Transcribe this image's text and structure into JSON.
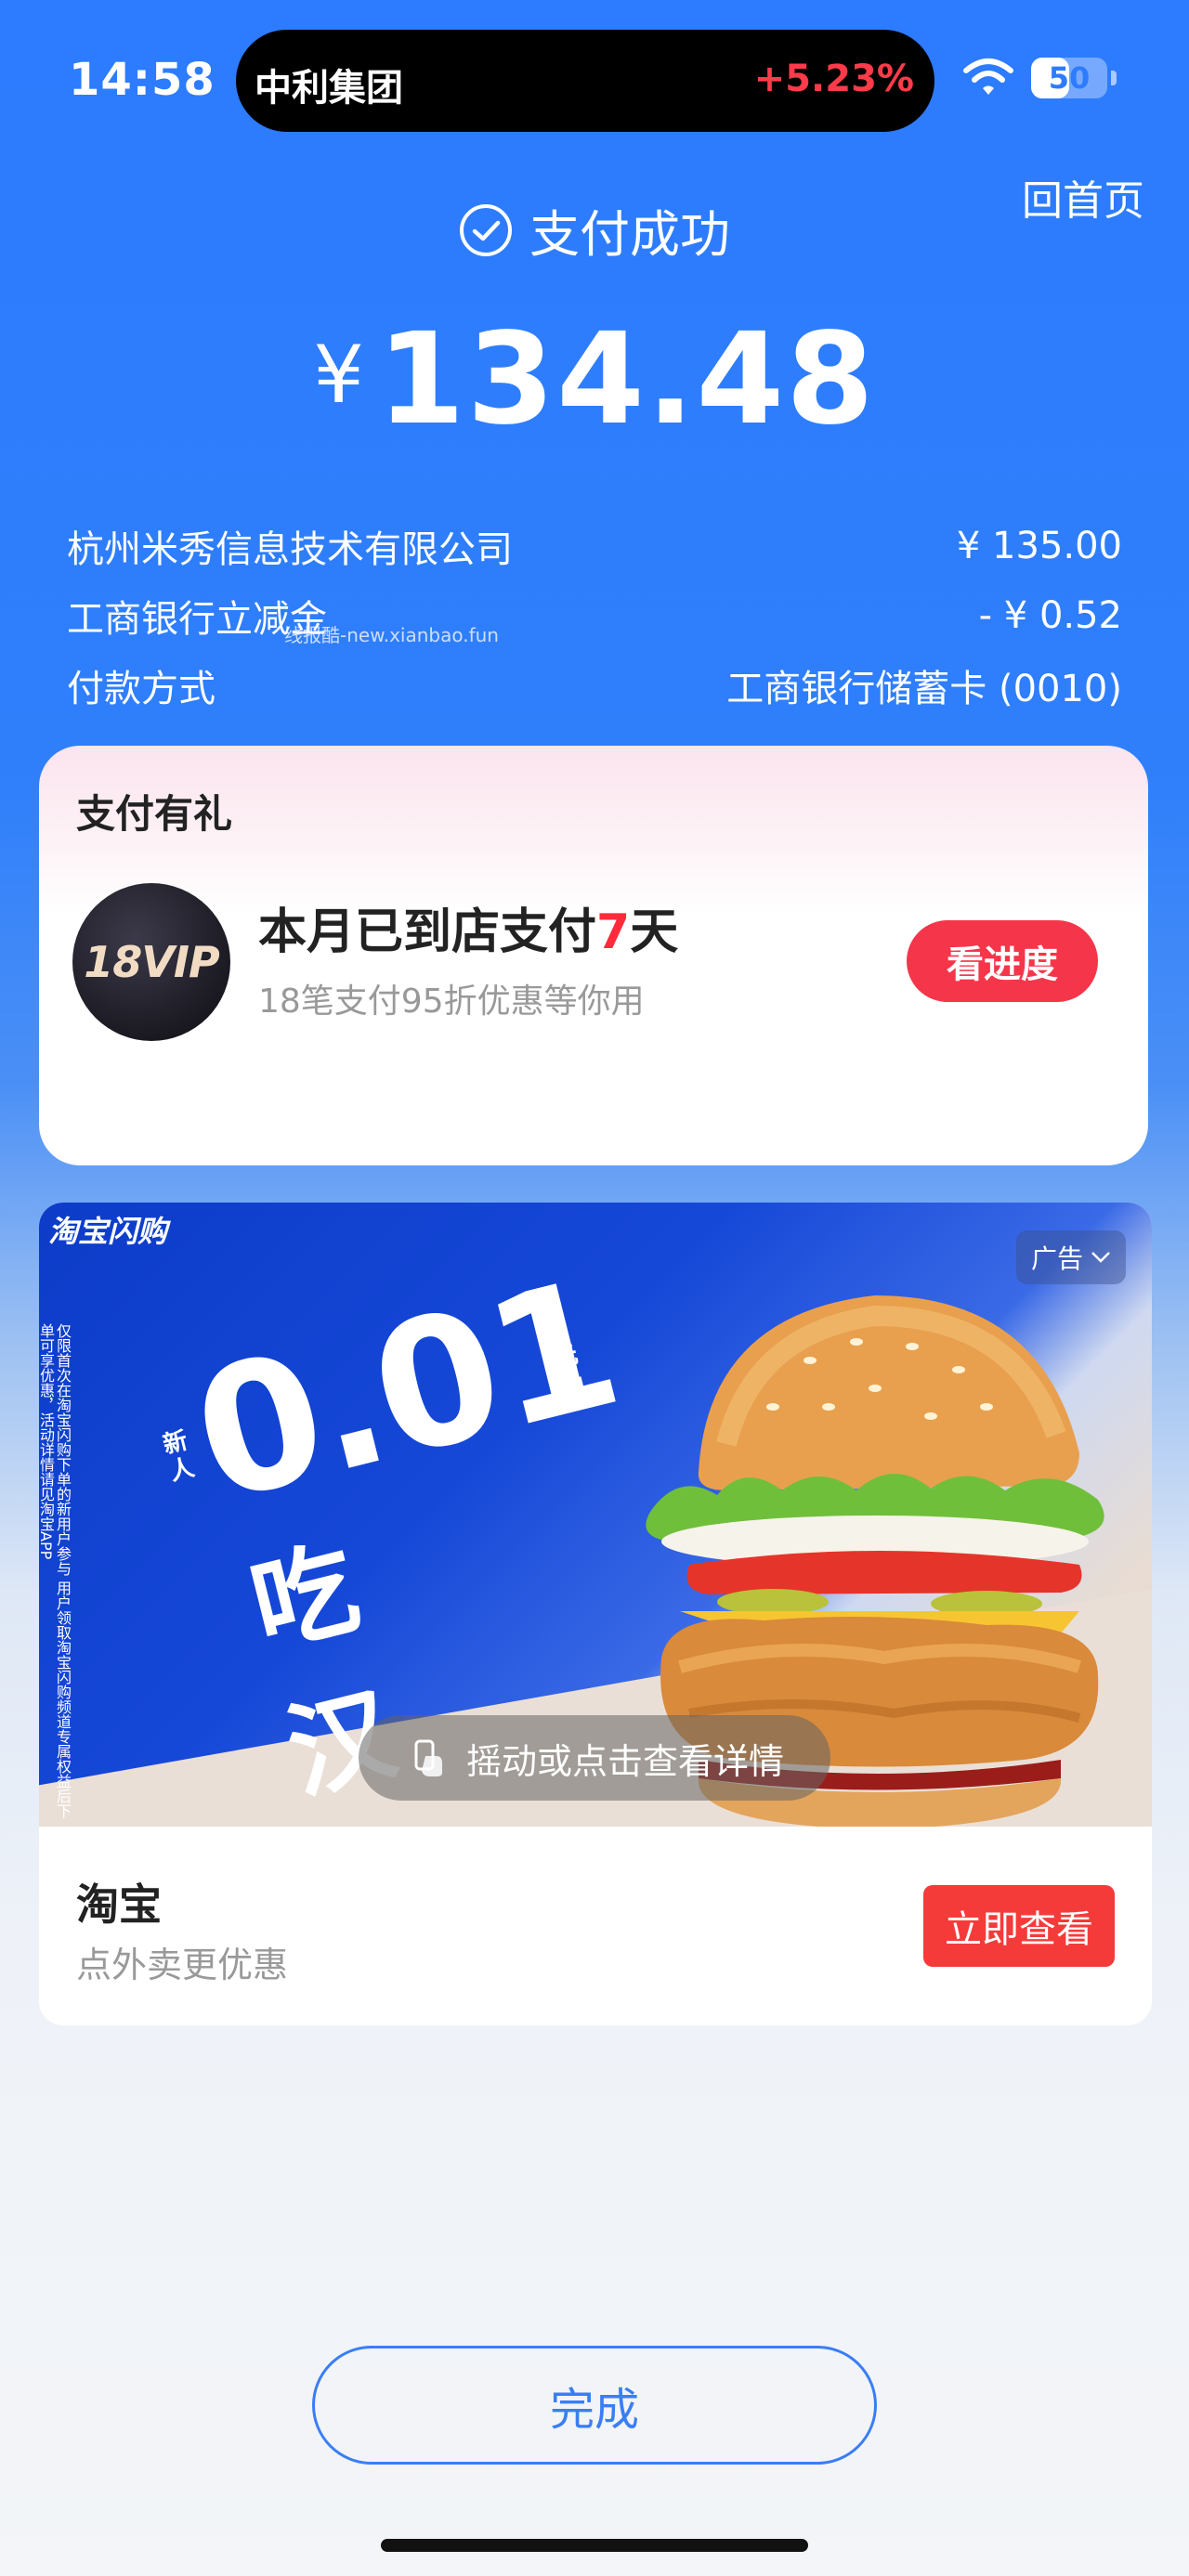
{
  "status_bar": {
    "time": "14:58",
    "stock_name": "中利集团",
    "stock_change": "+5.23%",
    "battery": "50",
    "battery_level_percent": 50
  },
  "header": {
    "home_link": "回首页",
    "status": "支付成功",
    "currency_symbol": "¥",
    "amount": "134.48"
  },
  "details": [
    {
      "label": "杭州米秀信息技术有限公司",
      "value": "¥ 135.00"
    },
    {
      "label": "工商银行立减金",
      "value": "- ¥ 0.52"
    },
    {
      "label": "付款方式",
      "value": "工商银行储蓄卡 (0010)"
    }
  ],
  "watermark": "线报酷-new.xianbao.fun",
  "gift_card": {
    "title": "支付有礼",
    "badge": "18VIP",
    "headline_prefix": "本月已到店支付",
    "headline_days": "7",
    "headline_suffix": "天",
    "subtitle": "18笔支付95折优惠等你用",
    "button": "看进度"
  },
  "ad_card": {
    "brand": "淘宝闪购",
    "ad_tag": "广告",
    "fine_print": "仅限首次在淘宝闪购下单的新用户参与 用户领取淘宝闪购频道专属权益后下单可享优惠，活动详情请见淘宝APP",
    "new_label": "新人",
    "price": "0.01",
    "price_suffix": "元起",
    "cta": "吃汉堡>",
    "shake_hint": "摇动或点击查看详情",
    "title": "淘宝",
    "subtitle": "点外卖更优惠",
    "button": "立即查看"
  },
  "done_button": "完成",
  "colors": {
    "primary_blue": "#2d7bff",
    "accent_red": "#f5364a",
    "highlight_red": "#ff2a3a"
  }
}
